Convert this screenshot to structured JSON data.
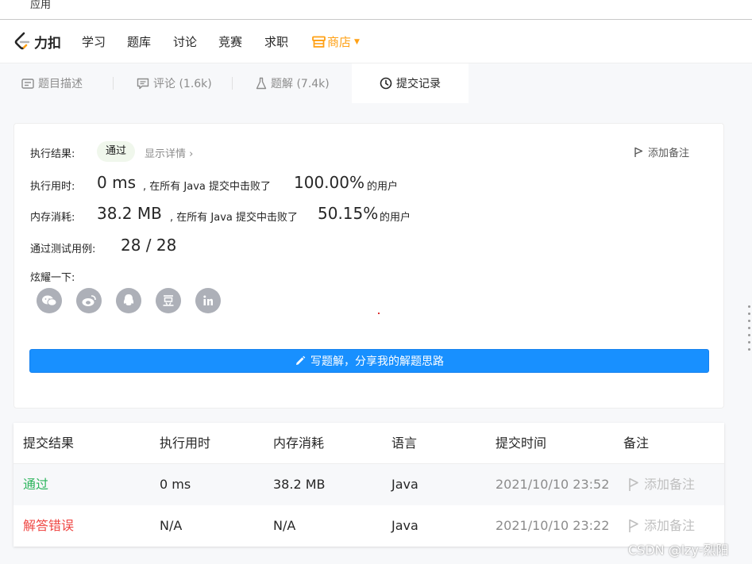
{
  "bookmarks": {
    "apps_label": "应用"
  },
  "nav": {
    "logo_text": "力扣",
    "items": [
      "学习",
      "题库",
      "讨论",
      "竞赛",
      "求职"
    ],
    "store_label": "商店",
    "brand_color": "#ffa116"
  },
  "tabs": [
    {
      "label": "题目描述",
      "icon": "description-icon"
    },
    {
      "label": "评论 (1.6k)",
      "icon": "comment-icon"
    },
    {
      "label": "题解 (7.4k)",
      "icon": "flask-icon"
    },
    {
      "label": "提交记录",
      "icon": "clock-icon",
      "active": true
    }
  ],
  "result": {
    "result_label": "执行结果:",
    "status": "通过",
    "detail_link": "显示详情 ›",
    "add_note": "添加备注",
    "runtime_label": "执行用时:",
    "runtime_value": "0 ms",
    "runtime_mid": ", 在所有 Java 提交中击败了",
    "runtime_percent": "100.00%",
    "runtime_tail": "的用户",
    "memory_label": "内存消耗:",
    "memory_value": "38.2 MB",
    "memory_mid": ", 在所有 Java 提交中击败了",
    "memory_percent": "50.15%",
    "memory_tail": "的用户",
    "testcases_label": "通过测试用例:",
    "testcases_value": "28 / 28",
    "share_label": "炫耀一下:",
    "share_icons": [
      "wechat-icon",
      "weibo-icon",
      "qq-icon",
      "douban-icon",
      "linkedin-icon"
    ],
    "write_solution": "写题解，分享我的解题思路",
    "accent_color": "#1890ff"
  },
  "submissions": {
    "headers": [
      "提交结果",
      "执行用时",
      "内存消耗",
      "语言",
      "提交时间",
      "备注"
    ],
    "rows": [
      {
        "status": "通过",
        "runtime": "0 ms",
        "memory": "38.2 MB",
        "language": "Java",
        "time": "2021/10/10 23:52",
        "note": "添加备注",
        "status_color": "#2db55d"
      },
      {
        "status": "解答错误",
        "runtime": "N/A",
        "memory": "N/A",
        "language": "Java",
        "time": "2021/10/10 23:22",
        "note": "添加备注",
        "status_color": "#ef4743"
      }
    ]
  },
  "watermark": "CSDN @lzy-烈阳"
}
